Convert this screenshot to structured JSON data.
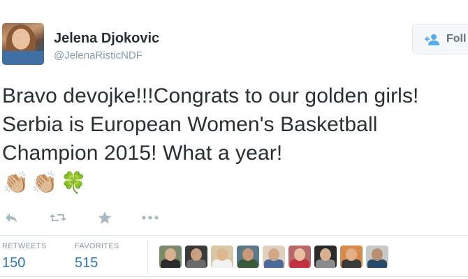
{
  "tweet": {
    "author_name": "Jelena Djokovic",
    "handle": "@JelenaRisticNDF",
    "follow_label": "Foll",
    "text": "Bravo devojke!!!Congrats to our golden girls! Serbia is European Women's Basketball Champion 2015! What a year!",
    "emojis": [
      "👏🏼",
      "👏🏼",
      "🍀"
    ]
  },
  "actions": {
    "reply_icon": "reply-icon",
    "retweet_icon": "retweet-icon",
    "favorite_icon": "star-icon",
    "more_icon": "more-icon"
  },
  "stats": {
    "retweets_label": "RETWEETS",
    "retweets_value": "150",
    "favorites_label": "FAVORITES",
    "favorites_value": "515"
  },
  "favoriters": [
    {
      "name": "favoriter-avatar-1",
      "bg": "#7a8a6a",
      "head": "#d8b090",
      "body": "#2a2a2a"
    },
    {
      "name": "favoriter-avatar-2",
      "bg": "#3a3a3a",
      "head": "#c8a080",
      "body": "#6a6a6a"
    },
    {
      "name": "favoriter-avatar-3",
      "bg": "#d8c8a8",
      "head": "#e0b890",
      "body": "#f2f2f2"
    },
    {
      "name": "favoriter-avatar-4",
      "bg": "#5a7a8a",
      "head": "#c89878",
      "body": "#3a5a3a"
    },
    {
      "name": "favoriter-avatar-5",
      "bg": "#e0d0c0",
      "head": "#d0a888",
      "body": "#4a6a9a"
    },
    {
      "name": "favoriter-avatar-6",
      "bg": "#b86a6a",
      "head": "#e8c0a0",
      "body": "#c03040"
    },
    {
      "name": "favoriter-avatar-7",
      "bg": "#2a2a2a",
      "head": "#d8b090",
      "body": "#8a8a8a"
    },
    {
      "name": "favoriter-avatar-8",
      "bg": "#d88a4a",
      "head": "#e0b088",
      "body": "#3a3a3a"
    },
    {
      "name": "favoriter-avatar-9",
      "bg": "#c8c8c8",
      "head": "#b89070",
      "body": "#2a4a6a"
    }
  ],
  "colors": {
    "text": "#292f33",
    "muted": "#8899a6",
    "link": "#2b7bb9",
    "border": "#e1e8ed",
    "follow_icon": "#55acee"
  }
}
